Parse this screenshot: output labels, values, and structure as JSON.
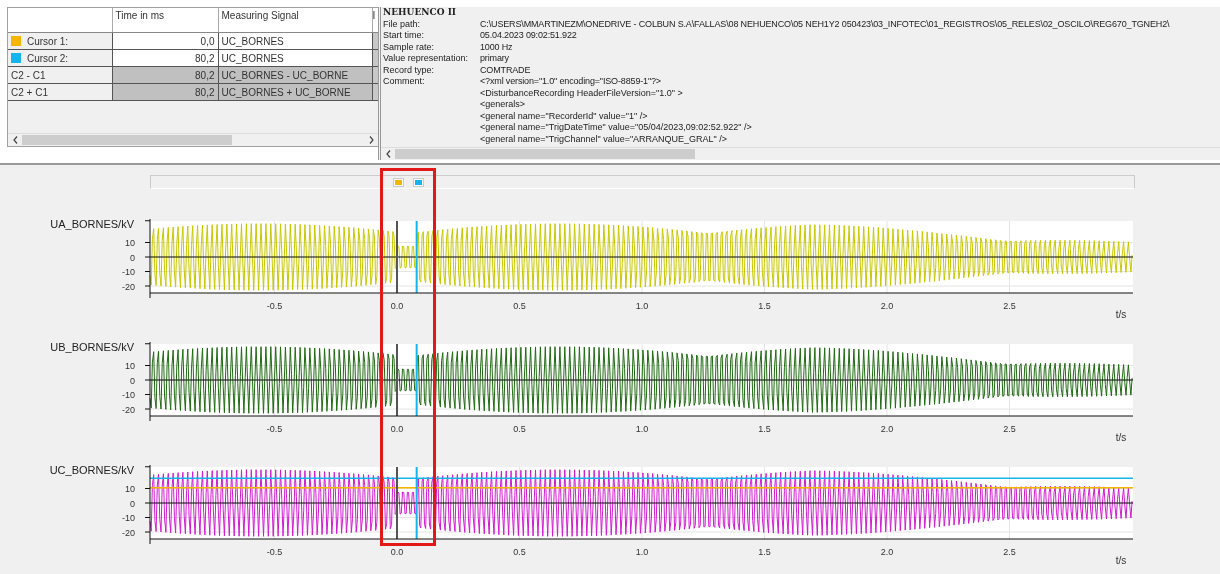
{
  "cursor_table": {
    "columns": [
      "Time in ms",
      "Measuring Signal",
      "I"
    ],
    "rows": [
      {
        "kind": "cursor",
        "label": "Cursor 1:",
        "color": "#f7b500",
        "time": "0,0",
        "signal": "UC_BORNES"
      },
      {
        "kind": "cursor",
        "label": "Cursor 2:",
        "color": "#14b4ef",
        "time": "80,2",
        "signal": "UC_BORNES"
      },
      {
        "kind": "calc",
        "label": "C2 - C1",
        "time": "80,2",
        "signal": "UC_BORNES - UC_BORNE"
      },
      {
        "kind": "calc",
        "label": "C2 + C1",
        "time": "80,2",
        "signal": "UC_BORNES + UC_BORNE"
      }
    ]
  },
  "record_info": {
    "title": "NEHUENCO II",
    "fields": [
      {
        "label": "File path:",
        "value": "C:\\USERS\\MMARTINEZM\\ONEDRIVE - COLBUN S.A\\FALLAS\\08 NEHUENCO\\05 NEH1Y2 050423\\03_INFOTEC\\01_REGISTROS\\05_RELES\\02_OSCILO\\REG670_TGNEH2\\"
      },
      {
        "label": "Start time:",
        "value": "05.04.2023 09:02:51.922"
      },
      {
        "label": "Sample rate:",
        "value": "1000 Hz"
      },
      {
        "label": "Value representation:",
        "value": "primary"
      },
      {
        "label": "Record type:",
        "value": "COMTRADE"
      },
      {
        "label": "Comment:",
        "value": "<?xml version=\"1.0\" encoding=\"ISO-8859-1\"?>"
      }
    ],
    "comment_lines": [
      "<DisturbanceRecording HeaderFileVersion=\"1.0\" >",
      "<generals>",
      "<general name=\"RecorderId\" value=\"1\" />",
      "<general name=\"TrigDateTime\" value=\"05/04/2023,09:02:52.922\" />",
      "<general name=\"TrigChannel\" value=\"ARRANQUE_GRAL\" />"
    ]
  },
  "plots": [
    {
      "label": "UA_BORNES/kV",
      "color": "#c8c800",
      "yticks": [
        "10",
        "0",
        "-10",
        "-20"
      ],
      "xticks": [
        "-0.5",
        "0.0",
        "0.5",
        "1.0",
        "1.5",
        "2.0",
        "2.5"
      ],
      "xlabel": "t/s"
    },
    {
      "label": "UB_BORNES/kV",
      "color": "#1f6b12",
      "yticks": [
        "10",
        "0",
        "-10",
        "-20"
      ],
      "xticks": [
        "-0.5",
        "0.0",
        "0.5",
        "1.0",
        "1.5",
        "2.0",
        "2.5"
      ],
      "xlabel": "t/s"
    },
    {
      "label": "UC_BORNES/kV",
      "color": "#d21ad2",
      "yticks": [
        "10",
        "0",
        "-10",
        "-20"
      ],
      "xticks": [
        "-0.5",
        "0.0",
        "0.5",
        "1.0",
        "1.5",
        "2.0",
        "2.5"
      ],
      "xlabel": "t/s"
    }
  ]
}
